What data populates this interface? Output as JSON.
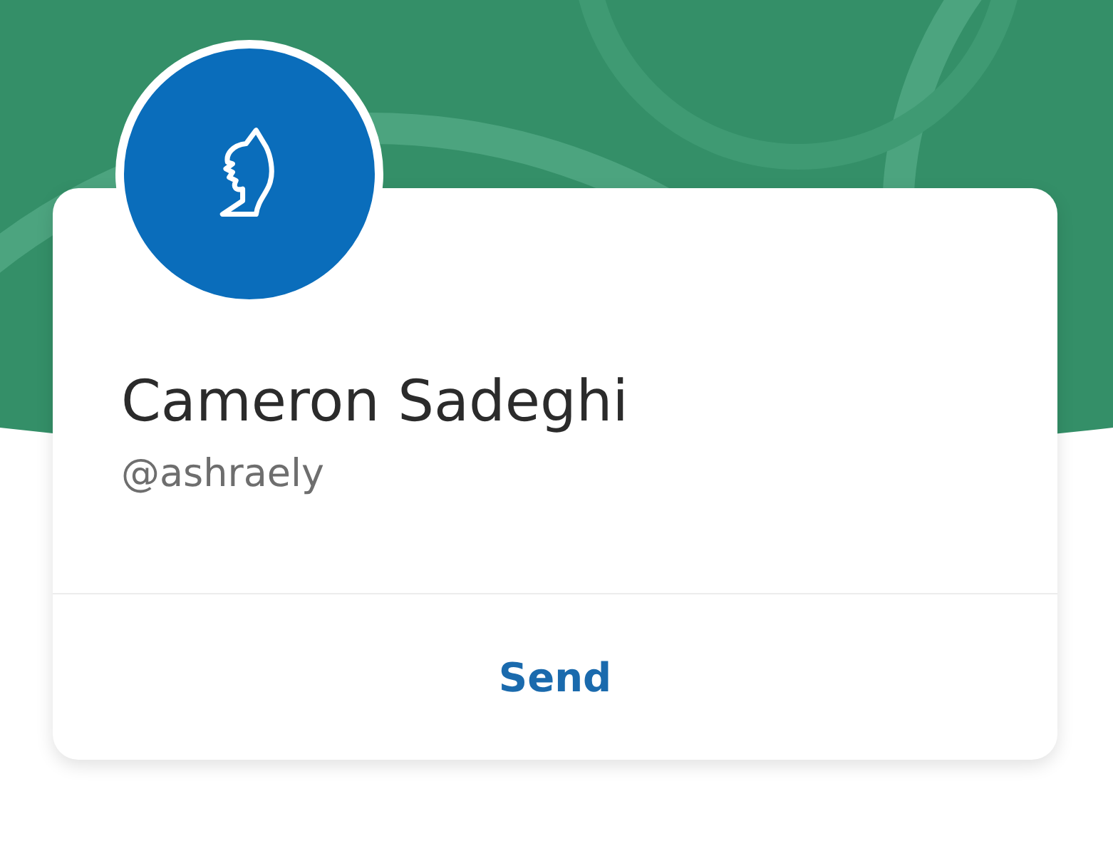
{
  "profile": {
    "name": "Cameron Sadeghi",
    "handle": "@ashraely"
  },
  "actions": [
    {
      "label": "Send"
    }
  ]
}
